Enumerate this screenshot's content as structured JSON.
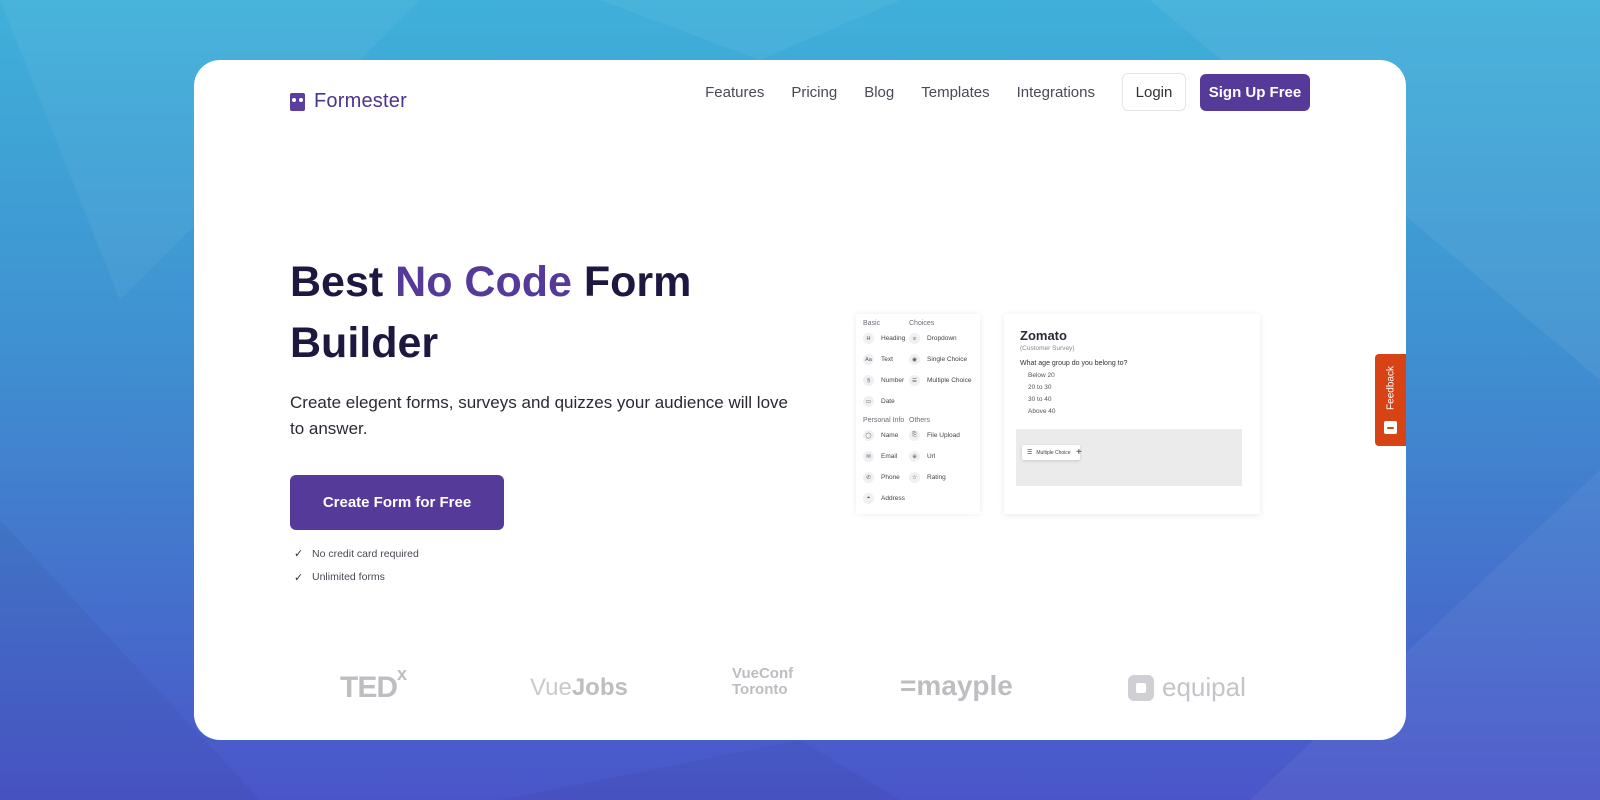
{
  "brand": {
    "name": "Formester",
    "color": "#553a9a"
  },
  "nav": {
    "links": [
      "Features",
      "Pricing",
      "Blog",
      "Templates",
      "Integrations"
    ],
    "login_label": "Login",
    "signup_label": "Sign Up Free"
  },
  "hero": {
    "title_part1": "Best ",
    "title_accent": "No Code",
    "title_part2": " Form Builder",
    "subtitle": "Create elegent forms, surveys and quizzes your audience will love to answer.",
    "cta_label": "Create Form for Free",
    "checks": [
      "No credit card required",
      "Unlimited forms"
    ]
  },
  "builder": {
    "headers": {
      "basic": "Basic",
      "choices": "Choices",
      "personal": "Personal Info",
      "others": "Others"
    },
    "basic_fields": [
      {
        "icon": "H",
        "label": "Heading"
      },
      {
        "icon": "Aa",
        "label": "Text"
      },
      {
        "icon": "§",
        "label": "Number"
      },
      {
        "icon": "▭",
        "label": "Date"
      }
    ],
    "choice_fields": [
      {
        "icon": "≡",
        "label": "Dropdown"
      },
      {
        "icon": "◉",
        "label": "Single Choice"
      },
      {
        "icon": "☰",
        "label": "Multiple Choice"
      }
    ],
    "personal_fields": [
      {
        "icon": "◯",
        "label": "Name"
      },
      {
        "icon": "✉",
        "label": "Email"
      },
      {
        "icon": "✆",
        "label": "Phone"
      },
      {
        "icon": "⌖",
        "label": "Address"
      }
    ],
    "other_fields": [
      {
        "icon": "⎘",
        "label": "File Upload"
      },
      {
        "icon": "⊕",
        "label": "Url"
      },
      {
        "icon": "☆",
        "label": "Rating"
      }
    ],
    "survey": {
      "title": "Zomato",
      "subtitle": "(Customer Survey)",
      "question": "What age group do you belong to?",
      "options": [
        "Below 20",
        "20 to 30",
        "30 to 40",
        "Above 40"
      ],
      "drag_chip_label": "Multiple Choice"
    }
  },
  "feedback_label": "Feedback",
  "logos": {
    "tedx": "TED",
    "tedx_sup": "x",
    "vuejobs_a": "Vue",
    "vuejobs_b": "Jobs",
    "vueconf_1": "VueConf",
    "vueconf_2": "Toronto",
    "mayple": "=mayple",
    "equipal": "equipal"
  }
}
